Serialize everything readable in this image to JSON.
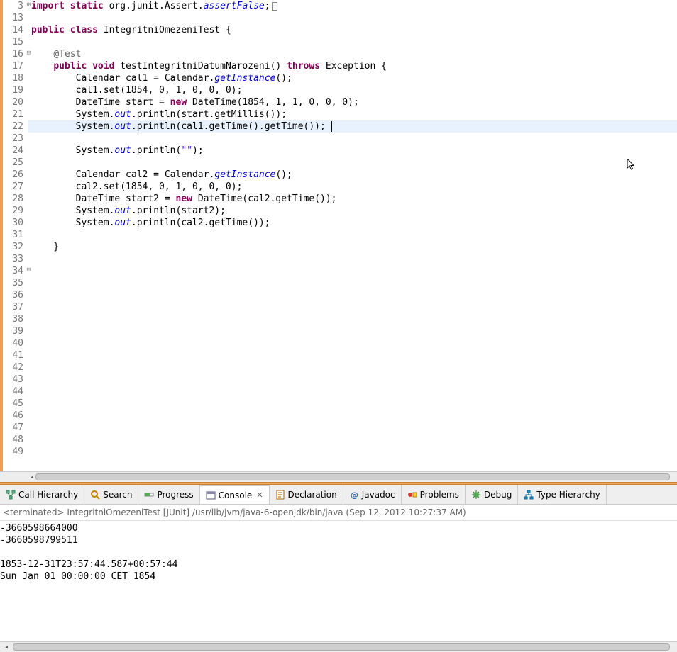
{
  "editor": {
    "lines": [
      {
        "n": 3,
        "fold": "plus",
        "tokens": [
          {
            "t": "import ",
            "c": "kw"
          },
          {
            "t": "static ",
            "c": "kw"
          },
          {
            "t": "org.junit.Assert."
          },
          {
            "t": "assertFalse",
            "c": "field-static"
          },
          {
            "t": ";"
          },
          {
            "t": "box",
            "c": "box"
          }
        ]
      },
      {
        "n": 13,
        "tokens": []
      },
      {
        "n": 14,
        "tokens": [
          {
            "t": "public ",
            "c": "kw"
          },
          {
            "t": "class ",
            "c": "kw"
          },
          {
            "t": "IntegritniOmezeniTest {"
          }
        ]
      },
      {
        "n": 15,
        "tokens": []
      },
      {
        "n": 16,
        "fold": "minus",
        "tokens": [
          {
            "t": "    "
          },
          {
            "t": "@Test",
            "c": "ann"
          }
        ]
      },
      {
        "n": 17,
        "tokens": [
          {
            "t": "    "
          },
          {
            "t": "public ",
            "c": "kw"
          },
          {
            "t": "void ",
            "c": "kw"
          },
          {
            "t": "testIntegritniDatumNarozeni() "
          },
          {
            "t": "throws ",
            "c": "kw"
          },
          {
            "t": "Exception {"
          }
        ]
      },
      {
        "n": 18,
        "tokens": [
          {
            "t": "        Calendar cal1 = Calendar."
          },
          {
            "t": "getInstance",
            "c": "field-static"
          },
          {
            "t": "();"
          }
        ]
      },
      {
        "n": 19,
        "tokens": [
          {
            "t": "        cal1.set(1854, 0, 1, 0, 0, 0);"
          }
        ]
      },
      {
        "n": 20,
        "tokens": [
          {
            "t": "        DateTime start = "
          },
          {
            "t": "new ",
            "c": "kw"
          },
          {
            "t": "DateTime(1854, 1, 1, 0, 0, 0);"
          }
        ]
      },
      {
        "n": 21,
        "tokens": [
          {
            "t": "        System."
          },
          {
            "t": "out",
            "c": "field-static"
          },
          {
            "t": ".println(start.getMillis());"
          }
        ]
      },
      {
        "n": 22,
        "hl": true,
        "tokens": [
          {
            "t": "        System."
          },
          {
            "t": "out",
            "c": "field-static"
          },
          {
            "t": ".println(cal1.getTime().getTime());"
          },
          {
            "t": "",
            "c": "cursor"
          }
        ]
      },
      {
        "n": 23,
        "tokens": []
      },
      {
        "n": 24,
        "tokens": [
          {
            "t": "        System."
          },
          {
            "t": "out",
            "c": "field-static"
          },
          {
            "t": ".println("
          },
          {
            "t": "\"\"",
            "c": "str"
          },
          {
            "t": ");"
          }
        ]
      },
      {
        "n": 25,
        "tokens": []
      },
      {
        "n": 26,
        "tokens": [
          {
            "t": "        Calendar cal2 = Calendar."
          },
          {
            "t": "getInstance",
            "c": "field-static"
          },
          {
            "t": "();"
          }
        ]
      },
      {
        "n": 27,
        "tokens": [
          {
            "t": "        cal2.set(1854, 0, 1, 0, 0, 0);"
          }
        ]
      },
      {
        "n": 28,
        "tokens": [
          {
            "t": "        DateTime start2 = "
          },
          {
            "t": "new ",
            "c": "kw"
          },
          {
            "t": "DateTime(cal2.getTime());"
          }
        ]
      },
      {
        "n": 29,
        "tokens": [
          {
            "t": "        System."
          },
          {
            "t": "out",
            "c": "field-static"
          },
          {
            "t": ".println(start2);"
          }
        ]
      },
      {
        "n": 30,
        "tokens": [
          {
            "t": "        System."
          },
          {
            "t": "out",
            "c": "field-static"
          },
          {
            "t": ".println(cal2.getTime());"
          }
        ]
      },
      {
        "n": 31,
        "tokens": []
      },
      {
        "n": 32,
        "tokens": [
          {
            "t": "    }"
          }
        ]
      },
      {
        "n": 33,
        "tokens": []
      },
      {
        "n": 34,
        "fold": "minus",
        "tokens": []
      },
      {
        "n": 35,
        "tokens": []
      },
      {
        "n": 36,
        "tokens": []
      },
      {
        "n": 37,
        "tokens": []
      },
      {
        "n": 38,
        "tokens": []
      },
      {
        "n": 39,
        "tokens": []
      },
      {
        "n": 40,
        "tokens": []
      },
      {
        "n": 41,
        "tokens": []
      },
      {
        "n": 42,
        "tokens": []
      },
      {
        "n": 43,
        "tokens": []
      },
      {
        "n": 44,
        "tokens": []
      },
      {
        "n": 45,
        "tokens": []
      },
      {
        "n": 46,
        "tokens": []
      },
      {
        "n": 47,
        "tokens": []
      },
      {
        "n": 48,
        "tokens": []
      },
      {
        "n": 49,
        "tokens": []
      }
    ]
  },
  "tabs": [
    {
      "id": "call-hierarchy",
      "label": "Call Hierarchy",
      "icon": "call-hierarchy-icon",
      "active": false
    },
    {
      "id": "search",
      "label": "Search",
      "icon": "search-icon",
      "active": false
    },
    {
      "id": "progress",
      "label": "Progress",
      "icon": "progress-icon",
      "active": false
    },
    {
      "id": "console",
      "label": "Console",
      "icon": "console-icon",
      "active": true,
      "closable": true
    },
    {
      "id": "declaration",
      "label": "Declaration",
      "icon": "declaration-icon",
      "active": false
    },
    {
      "id": "javadoc",
      "label": "Javadoc",
      "icon": "javadoc-icon",
      "active": false
    },
    {
      "id": "problems",
      "label": "Problems",
      "icon": "problems-icon",
      "active": false
    },
    {
      "id": "debug",
      "label": "Debug",
      "icon": "debug-icon",
      "active": false
    },
    {
      "id": "type-hierarchy",
      "label": "Type Hierarchy",
      "icon": "type-hierarchy-icon",
      "active": false
    }
  ],
  "console": {
    "header": "<terminated> IntegritniOmezeniTest [JUnit] /usr/lib/jvm/java-6-openjdk/bin/java (Sep 12, 2012 10:27:37 AM)",
    "lines": [
      "-3660598664000",
      "-3660598799511",
      "",
      "1853-12-31T23:57:44.587+00:57:44",
      "Sun Jan 01 00:00:00 CET 1854"
    ]
  },
  "close_glyph": "✕"
}
